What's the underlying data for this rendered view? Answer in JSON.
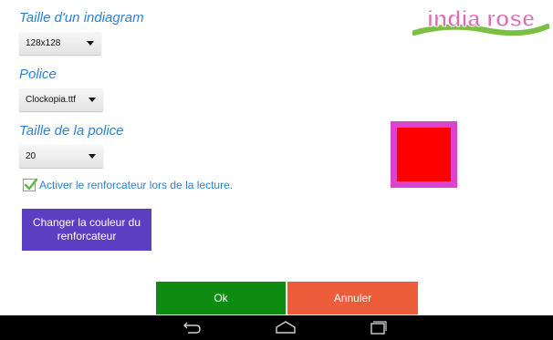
{
  "logo": {
    "text": "india rose"
  },
  "settings": {
    "indiagram_size": {
      "heading": "Taille d'un indiagram",
      "value": "128x128"
    },
    "font": {
      "heading": "Police",
      "value": "Clockopia.ttf"
    },
    "font_size": {
      "heading": "Taille de la police",
      "value": "20"
    },
    "reinforcer_checkbox": {
      "label": "Activer le renforcateur lors de la lecture.",
      "checked": true
    },
    "change_color_button": {
      "label": "Changer la couleur du renforcateur"
    }
  },
  "preview": {
    "border_color": "#dd44cc",
    "fill_color": "#ff0000"
  },
  "actions": {
    "ok": {
      "label": "Ok",
      "color": "#0e8c12"
    },
    "cancel": {
      "label": "Annuler",
      "color": "#ee5d3b"
    }
  },
  "navbar": {
    "icons": [
      "back-icon",
      "home-icon",
      "recent-apps-icon"
    ]
  }
}
